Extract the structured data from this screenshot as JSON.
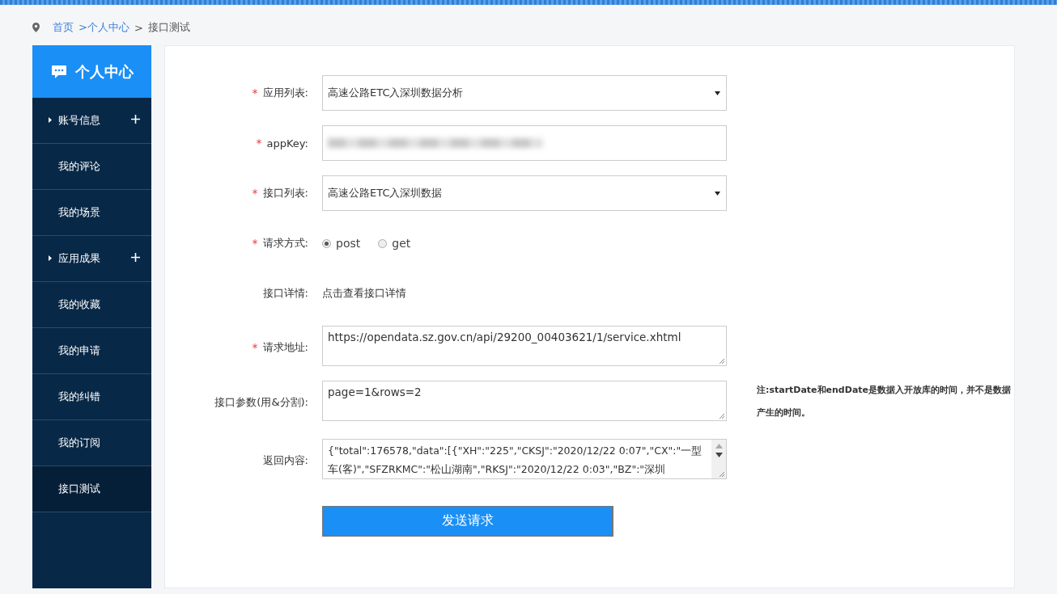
{
  "breadcrumb": [
    {
      "label": "首页",
      "kind": "link"
    },
    {
      "label": ">个人中心",
      "kind": "link"
    },
    {
      "label": ">",
      "kind": "text"
    },
    {
      "label": "接口测试",
      "kind": "text"
    }
  ],
  "sidebar": {
    "title": "个人中心",
    "items": [
      {
        "label": "账号信息",
        "expandable": true,
        "selected": false
      },
      {
        "label": "我的评论",
        "expandable": false,
        "selected": false
      },
      {
        "label": "我的场景",
        "expandable": false,
        "selected": false
      },
      {
        "label": "应用成果",
        "expandable": true,
        "selected": false
      },
      {
        "label": "我的收藏",
        "expandable": false,
        "selected": false
      },
      {
        "label": "我的申请",
        "expandable": false,
        "selected": false
      },
      {
        "label": "我的纠错",
        "expandable": false,
        "selected": false
      },
      {
        "label": "我的订阅",
        "expandable": false,
        "selected": false
      },
      {
        "label": "接口测试",
        "expandable": false,
        "selected": true
      }
    ]
  },
  "form": {
    "fields": [
      {
        "kind": "select",
        "asterisk": "*",
        "label": "应用列表:",
        "value": "高速公路ETC入深圳数据分析"
      },
      {
        "kind": "redacted",
        "asterisk": "*",
        "label": "appKey:"
      },
      {
        "kind": "select",
        "asterisk": "*",
        "label": "接口列表:",
        "value": "高速公路ETC入深圳数据"
      },
      {
        "kind": "radio",
        "asterisk": "*",
        "label": "请求方式:",
        "options": [
          {
            "label": "post",
            "selected": true
          },
          {
            "label": "get",
            "selected": false
          }
        ]
      },
      {
        "kind": "link",
        "label": "接口详情:",
        "value": "点击查看接口详情"
      },
      {
        "kind": "textarea",
        "asterisk": "*",
        "label": "请求地址:",
        "value": "https://opendata.sz.gov.cn/api/29200_00403621/1/service.xhtml"
      },
      {
        "kind": "textarea",
        "label": "接口参数(用&分割):",
        "value": "page=1&rows=2",
        "note": "注:startDate和endDate是数据入开放库的时间，并不是数据产生的时间。"
      },
      {
        "kind": "response",
        "label": "返回内容:",
        "value": "{\"total\":176578,\"data\":[{\"XH\":\"225\",\"CKSJ\":\"2020/12/22 0:07\",\"CX\":\"一型车(客)\",\"SFZRKMC\":\"松山湖南\",\"RKSJ\":\"2020/12/22 0:03\",\"BZ\":\"深圳"
      }
    ],
    "submit": "发送请求"
  }
}
